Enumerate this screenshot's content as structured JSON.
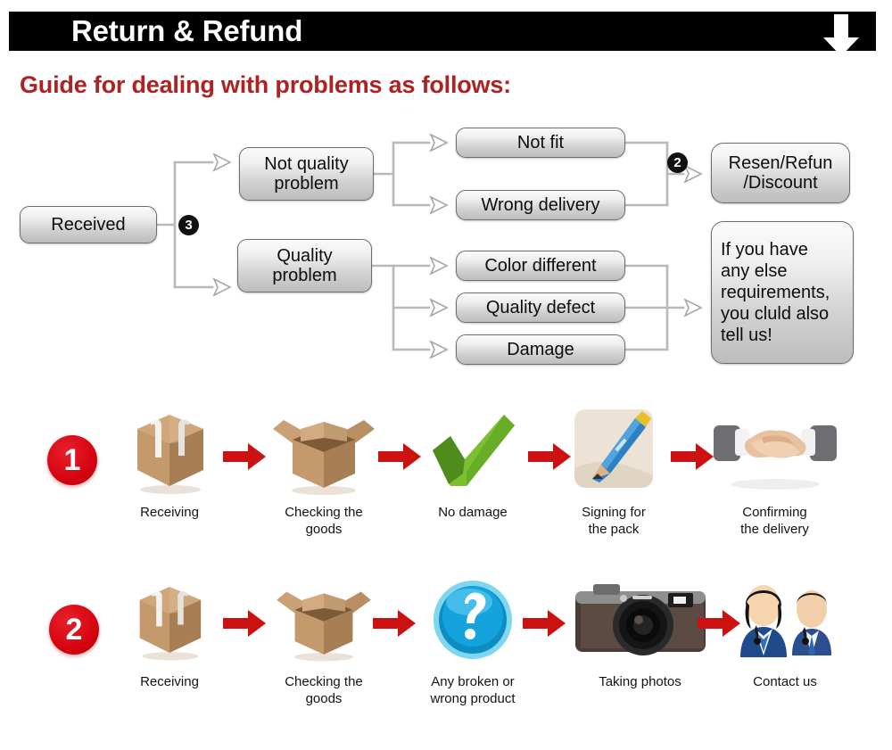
{
  "header": {
    "title": "Return & Refund",
    "down_arrow_icon": "arrow-down-icon",
    "bar_color": "#000000",
    "title_color": "#ffffff"
  },
  "guide": {
    "heading": "Guide for dealing with problems as follows:",
    "heading_color": "#ad2222"
  },
  "flowchart": {
    "start": {
      "label": "Received"
    },
    "badge_three": "3",
    "badge_two": "2",
    "branches": [
      {
        "label": "Not quality\nproblem",
        "line1": "Not quality",
        "line2": "problem"
      },
      {
        "label": "Quality\nproblem",
        "line1": "Quality",
        "line2": "problem"
      }
    ],
    "not_quality_children": [
      {
        "label": "Not fit"
      },
      {
        "label": "Wrong delivery"
      }
    ],
    "quality_children": [
      {
        "label": "Color different"
      },
      {
        "label": "Quality defect"
      },
      {
        "label": "Damage"
      }
    ],
    "outcomes": [
      {
        "line1": "Resen/Refun",
        "line2": "/Discount"
      },
      {
        "lines": [
          "If you have",
          "any else",
          "requirements,",
          "you cluld also",
          "tell us!"
        ]
      }
    ]
  },
  "steps": {
    "badge_color": "#d4040f",
    "arrow_color": "#cc1111",
    "rows": [
      {
        "badge": "1",
        "items": [
          {
            "icon": "sealed-box-icon",
            "label": "Receiving"
          },
          {
            "icon": "open-box-icon",
            "label": "Checking the\ngoods",
            "line1": "Checking the",
            "line2": "goods"
          },
          {
            "icon": "green-check-icon",
            "label": "No damage"
          },
          {
            "icon": "pencil-signing-icon",
            "label": "Signing for\nthe pack",
            "line1": "Signing for",
            "line2": "the pack"
          },
          {
            "icon": "handshake-icon",
            "label": "Confirming\nthe delivery",
            "line1": "Confirming",
            "line2": "the delivery"
          }
        ]
      },
      {
        "badge": "2",
        "items": [
          {
            "icon": "sealed-box-icon",
            "label": "Receiving"
          },
          {
            "icon": "open-box-icon",
            "label": "Checking the\ngoods",
            "line1": "Checking the",
            "line2": "goods"
          },
          {
            "icon": "question-mark-icon",
            "label": "Any broken or\nwrong product",
            "line1": "Any broken or",
            "line2": "wrong product"
          },
          {
            "icon": "camera-icon",
            "label": "Taking photos"
          },
          {
            "icon": "support-people-icon",
            "label": "Contact us"
          }
        ]
      }
    ]
  }
}
